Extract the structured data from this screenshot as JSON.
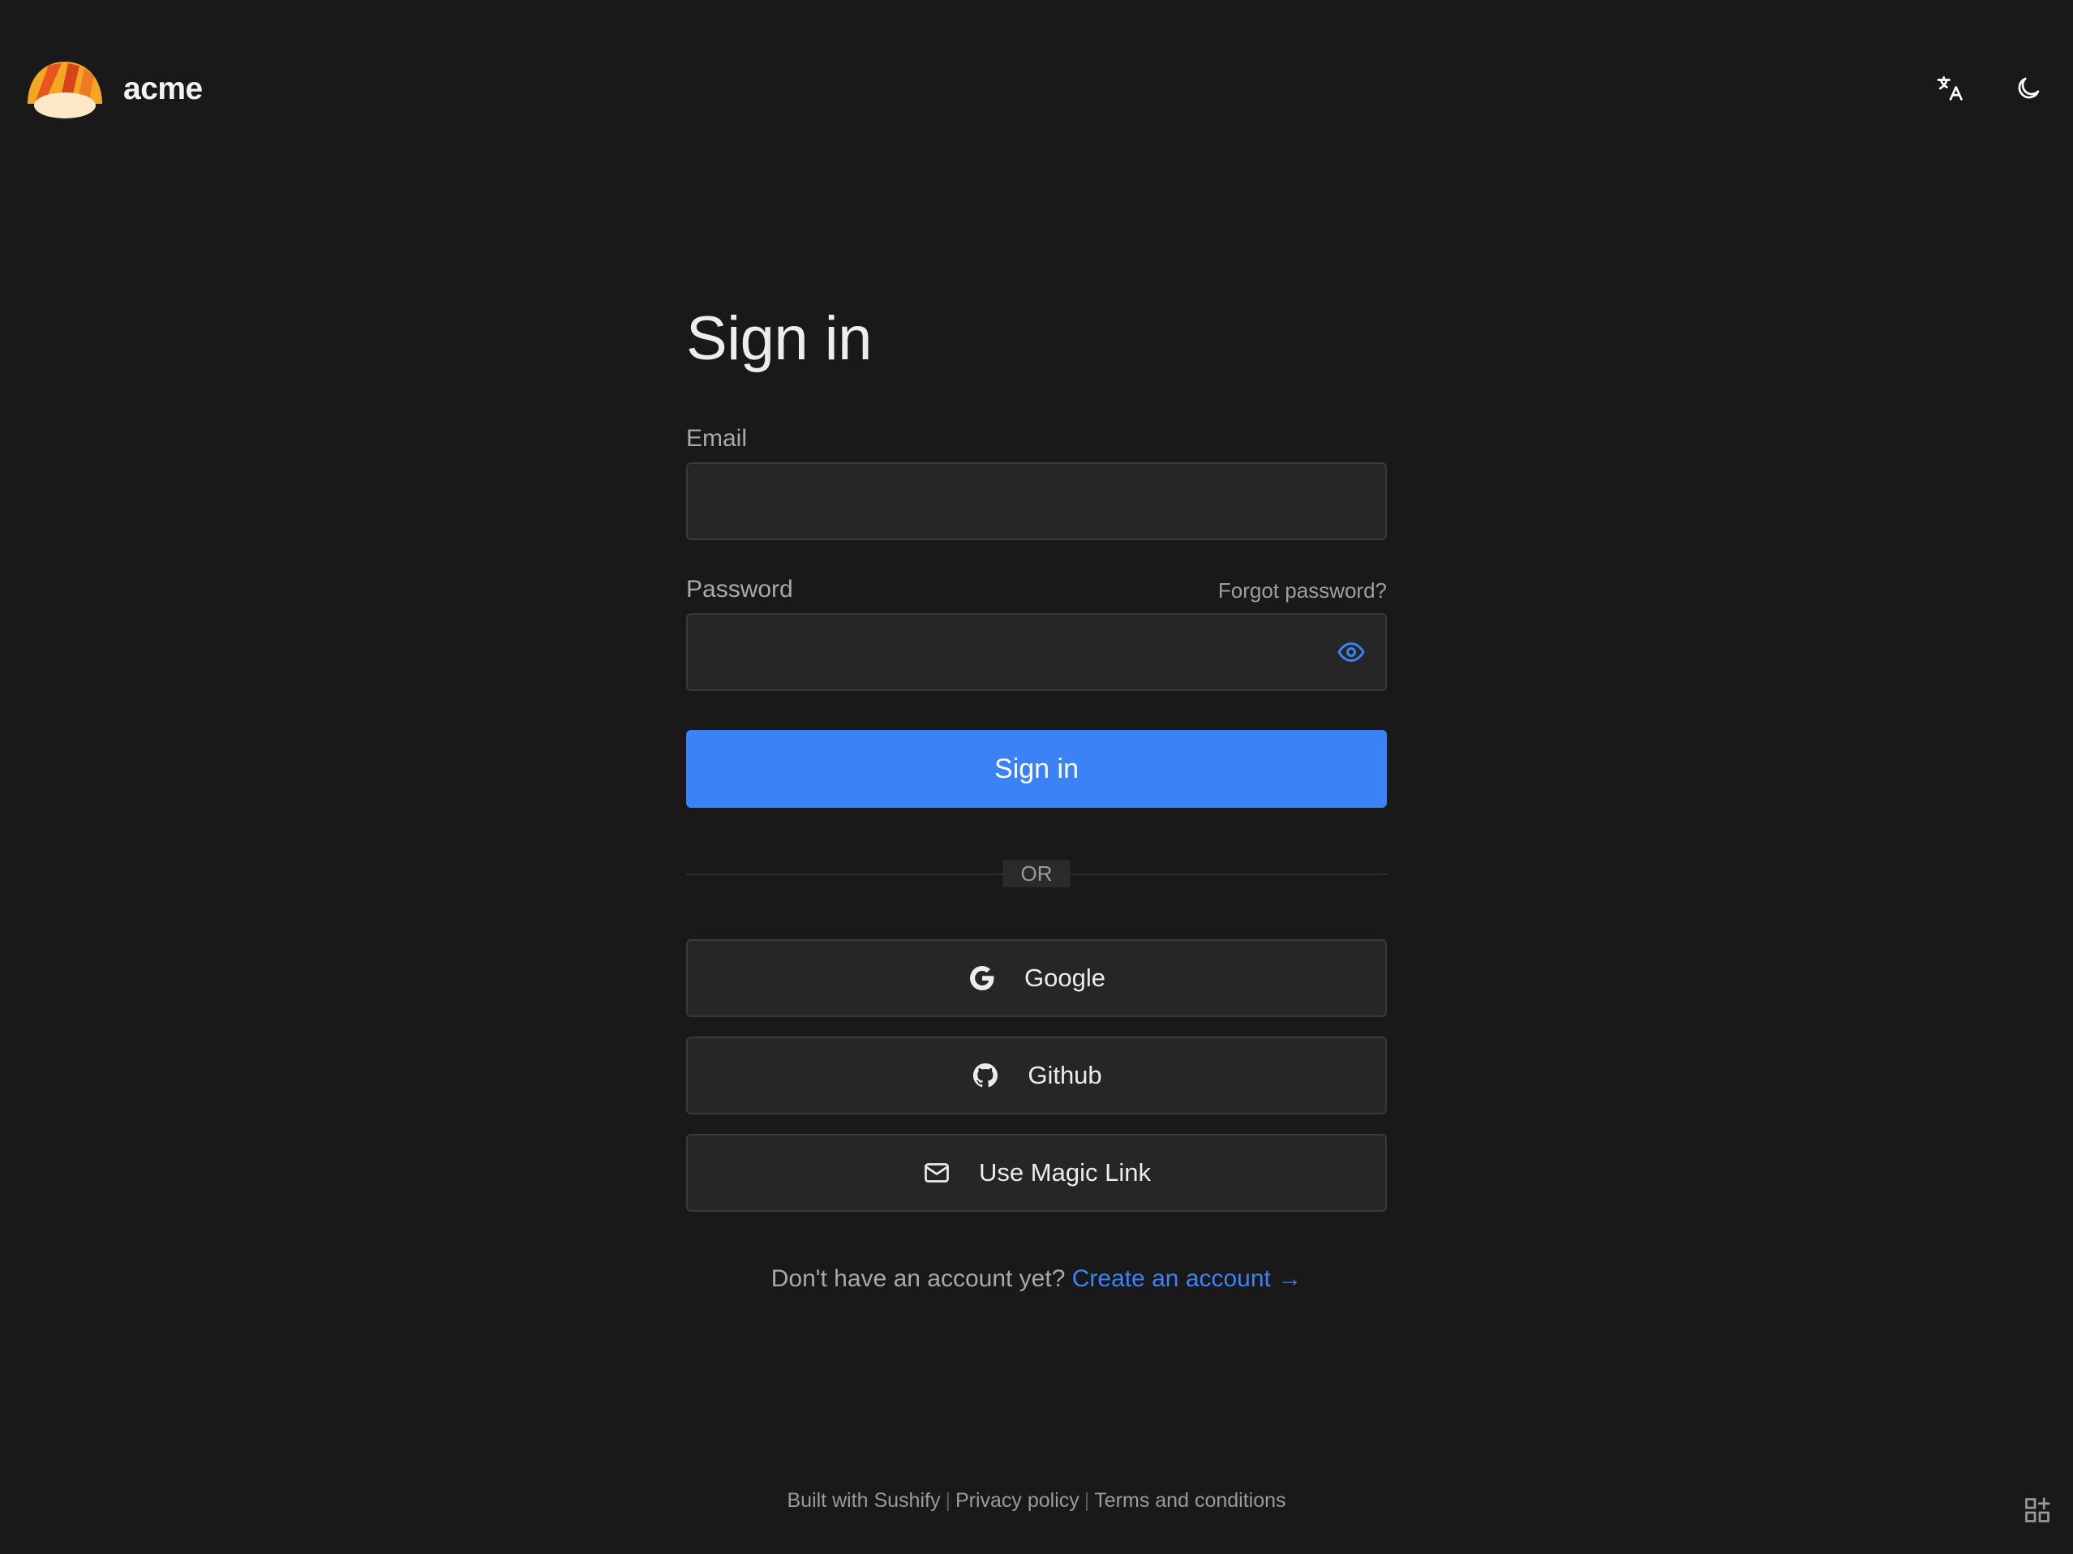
{
  "header": {
    "brand_name": "acme",
    "logo_icon": "sushi-logo-icon",
    "translate_icon": "translate-icon",
    "theme_icon": "moon-icon"
  },
  "form": {
    "title": "Sign in",
    "email_label": "Email",
    "email_value": "",
    "password_label": "Password",
    "password_value": "",
    "forgot_password": "Forgot password?",
    "submit_label": "Sign in",
    "divider_text": "OR",
    "providers": [
      {
        "label": "Google",
        "icon": "google-icon"
      },
      {
        "label": "Github",
        "icon": "github-icon"
      },
      {
        "label": "Use Magic Link",
        "icon": "mail-icon"
      }
    ],
    "signup_prompt": "Don't have an account yet?",
    "signup_link": "Create an account →"
  },
  "footer": {
    "built_with": "Built with Sushify",
    "privacy": "Privacy policy",
    "terms": "Terms and conditions",
    "separator": "|"
  },
  "colors": {
    "background": "#191919",
    "accent": "#3b82f6",
    "input_bg": "#262626",
    "border": "#3a3a3a"
  }
}
